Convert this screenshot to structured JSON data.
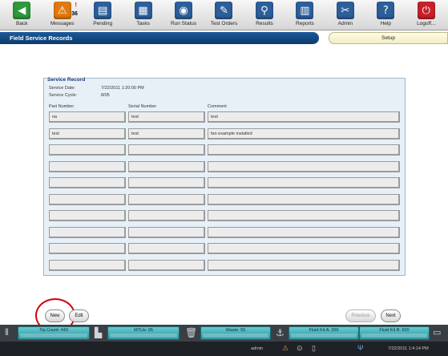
{
  "toolbar": {
    "items": [
      {
        "label": "Back",
        "icon": "back-arrow-icon",
        "color": "#2e9a3a",
        "glyph": "◀"
      },
      {
        "label": "Messages",
        "icon": "warning-icon",
        "color": "#e07a10",
        "glyph": "⚠",
        "count": "36",
        "alert": "!"
      },
      {
        "label": "Pending",
        "icon": "clipboard-icon",
        "color": "#2d5f9b",
        "glyph": "▤"
      },
      {
        "label": "Tasks",
        "icon": "tasks-icon",
        "color": "#2d5f9b",
        "glyph": "▦"
      },
      {
        "label": "Run Status",
        "icon": "run-status-icon",
        "color": "#2d5f9b",
        "glyph": "◉"
      },
      {
        "label": "Test Orders",
        "icon": "test-orders-icon",
        "color": "#2d5f9b",
        "glyph": "✎"
      },
      {
        "label": "Results",
        "icon": "results-search-icon",
        "color": "#2d5f9b",
        "glyph": "⚲"
      },
      {
        "label": "Reports",
        "icon": "reports-icon",
        "color": "#2d5f9b",
        "glyph": "▥"
      },
      {
        "label": "Admin",
        "icon": "admin-tools-icon",
        "color": "#2d5f9b",
        "glyph": "✂"
      },
      {
        "label": "Help",
        "icon": "help-icon",
        "color": "#2d5f9b",
        "glyph": "?"
      },
      {
        "label": "Logoff...",
        "icon": "power-icon",
        "color": "#c8202a",
        "glyph": "⏻"
      }
    ]
  },
  "titlebar": {
    "title": "Field Service Records"
  },
  "setup": {
    "label": "Setup"
  },
  "record": {
    "section_title": "Service Record",
    "service_date_label": "Service Date:",
    "service_date_value": "7/22/2011 1:20:00 PM",
    "service_cycle_label": "Service Cycle:",
    "service_cycle_value": "8/05",
    "columns": [
      "Part Number",
      "Serial Number",
      "Comment"
    ],
    "rows": [
      [
        "na",
        "test",
        "test"
      ],
      [
        "test",
        "test",
        "fan example installed"
      ],
      [
        "",
        "",
        ""
      ],
      [
        "",
        "",
        ""
      ],
      [
        "",
        "",
        ""
      ],
      [
        "",
        "",
        ""
      ],
      [
        "",
        "",
        ""
      ],
      [
        "",
        "",
        ""
      ],
      [
        "",
        "",
        ""
      ],
      [
        "",
        "",
        ""
      ]
    ]
  },
  "buttons": {
    "new": "New",
    "edit": "Edit",
    "previous": "Previous",
    "next": "Next"
  },
  "status": {
    "tip_count": "Tip Count: 443",
    "mtus": "MTUs: 95",
    "waste": "Waste: 55",
    "fluid_a": "Fluid Kit A: 200",
    "fluid_b": "Fluid Kit B: 920"
  },
  "infobar": {
    "user": "admin",
    "datetime": "7/22/2011 1:4:14 PM"
  },
  "colors": {
    "highlight": "#d4000d",
    "title_bg": "#0d3a6c",
    "panel_bg": "#e7f0f7"
  }
}
